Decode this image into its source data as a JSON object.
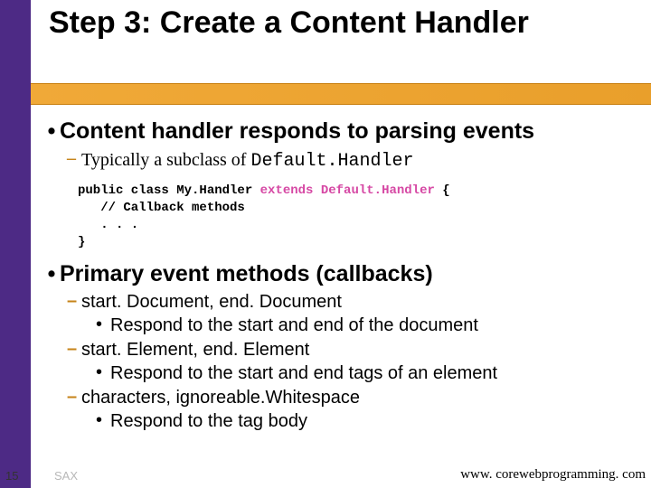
{
  "title": "Step 3: Create a Content Handler",
  "bullets": [
    {
      "text": "Content handler responds to parsing events",
      "subs": [
        {
          "prefix": "Typically a subclass of ",
          "mono": "Default.Handler"
        }
      ],
      "code": {
        "l1a": "public class My.Handler ",
        "l1b": "extends Default.Handler",
        "l1c": " {",
        "l2": "   // Callback methods",
        "l3": "   . . .",
        "l4": "}"
      }
    },
    {
      "text": "Primary event methods (callbacks)",
      "subs2": [
        {
          "label": "start. Document, end. Document",
          "desc": "Respond to the start and end of the document"
        },
        {
          "label": "start. Element, end. Element",
          "desc": "Respond to the start and end tags of an element"
        },
        {
          "label": "characters, ignoreable.Whitespace",
          "desc": "Respond to the tag body"
        }
      ]
    }
  ],
  "footer": {
    "page": "15",
    "label": "SAX",
    "url": "www. corewebprogramming. com"
  }
}
